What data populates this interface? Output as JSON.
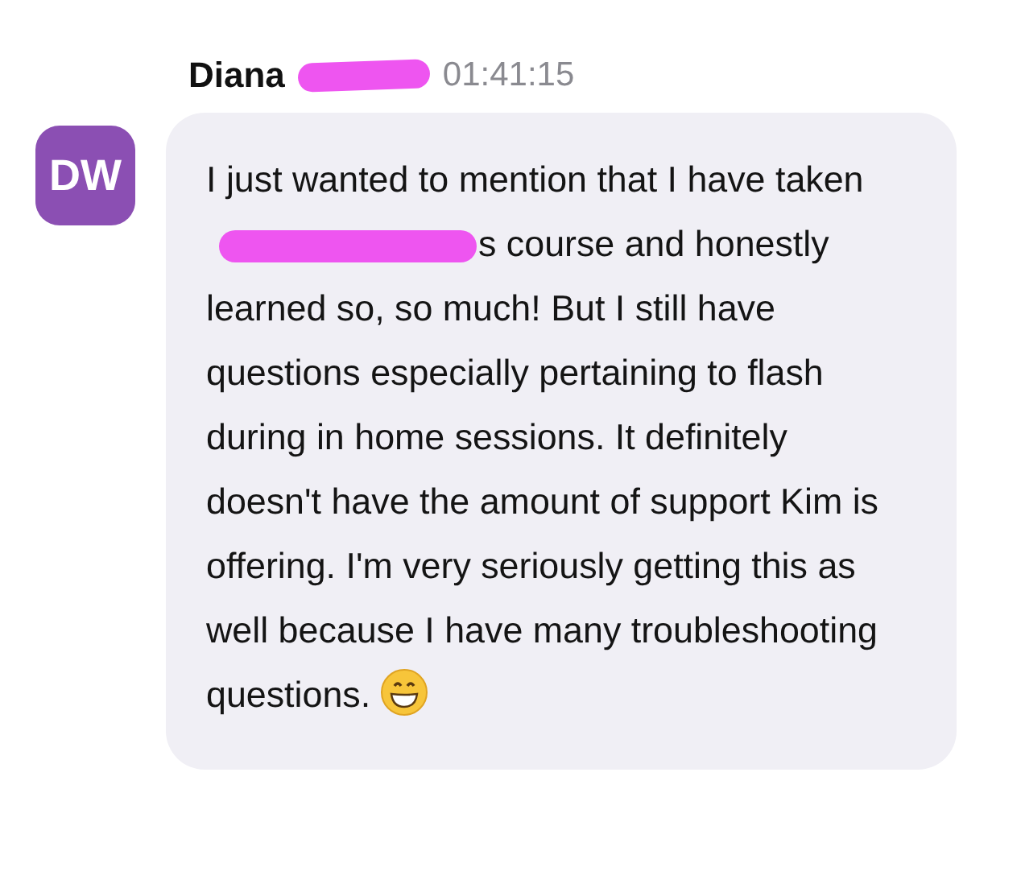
{
  "message": {
    "author": "Diana",
    "author_redacted": true,
    "time": "01:41:15",
    "avatar_initials": "DW",
    "text_before": "I just wanted to mention that I have taken",
    "text_redacted": true,
    "text_after": "s course and honestly learned so, so much! But I still have questions especially pertaining to flash during in home sessions. It definitely doesn't have the amount of support Kim is offering. I'm very seriously getting this as well because I have many troubleshooting questions."
  }
}
